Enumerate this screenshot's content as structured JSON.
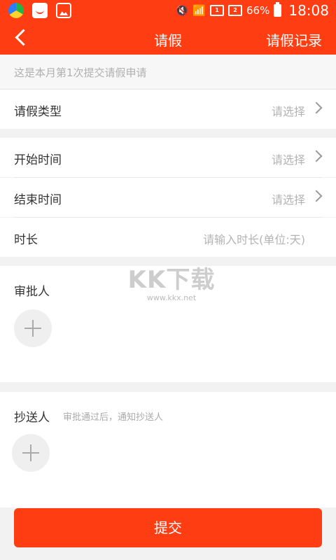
{
  "status_bar": {
    "battery": "66%",
    "time": "18:08",
    "icons": [
      "app-store-icon",
      "shopping-icon",
      "gallery-icon",
      "mute-icon",
      "wifi-icon",
      "sim-icon",
      "sim-icon",
      "battery-icon"
    ]
  },
  "nav": {
    "title": "请假",
    "right": "请假记录",
    "back_icon": "back-arrow-icon"
  },
  "hint": "这是本月第1次提交请假申请",
  "fields": {
    "leave_type": {
      "label": "请假类型",
      "value": "请选择"
    },
    "start_time": {
      "label": "开始时间",
      "value": "请选择"
    },
    "end_time": {
      "label": "结束时间",
      "value": "请选择"
    },
    "duration": {
      "label": "时长",
      "placeholder": "请输入时长(单位:天)"
    }
  },
  "approver": {
    "title": "审批人"
  },
  "cc": {
    "title": "抄送人",
    "hint": "审批通过后，通知抄送人"
  },
  "watermark": {
    "main": "KK下载",
    "sub": "www.kkx.net"
  },
  "submit": "提交",
  "colors": {
    "accent": "#ff3d12"
  }
}
